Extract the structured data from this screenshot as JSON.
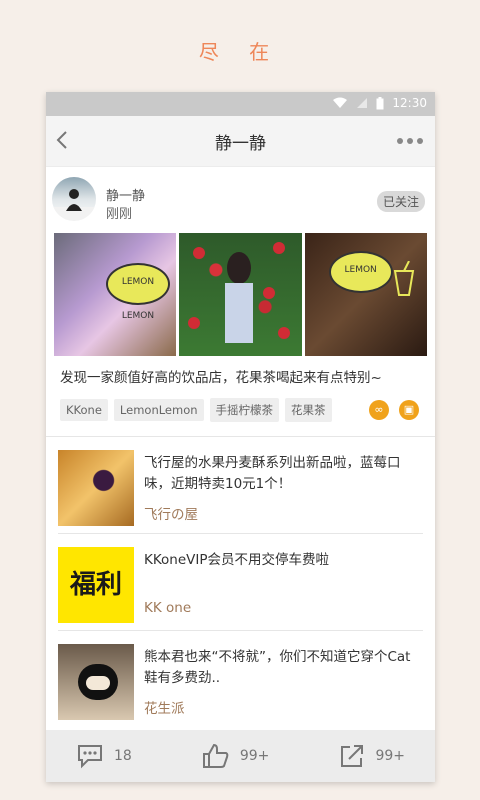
{
  "tagline": "尽 在",
  "status": {
    "time": "12:30"
  },
  "nav": {
    "title": "静一静"
  },
  "post": {
    "author": "静一静",
    "time": "刚刚",
    "follow_label": "已关注",
    "caption": "发现一家颜值好高的饮品店，花果茶喝起来有点特别~",
    "tags": [
      "KKone",
      "LemonLemon",
      "手摇柠檬茶",
      "花果茶"
    ],
    "photo_text": [
      "LEMON LEMON",
      "LEMON"
    ]
  },
  "articles": [
    {
      "title": "飞行屋的水果丹麦酥系列出新品啦，蓝莓口味，近期特卖10元1个！",
      "source": "飞行の屋"
    },
    {
      "title": "KKoneVIP会员不用交停车费啦",
      "source": "KK one",
      "thumb_text": "福利"
    },
    {
      "title": "熊本君也来“不将就”，你们不知道它穿个Cat鞋有多费劲..",
      "source": "花生派"
    }
  ],
  "actions": {
    "comments": "18",
    "likes": "99+",
    "shares": "99+"
  },
  "colors": {
    "accent": "#ee8759",
    "source": "#a07a5a",
    "tag_icon": "#f0a21b"
  }
}
